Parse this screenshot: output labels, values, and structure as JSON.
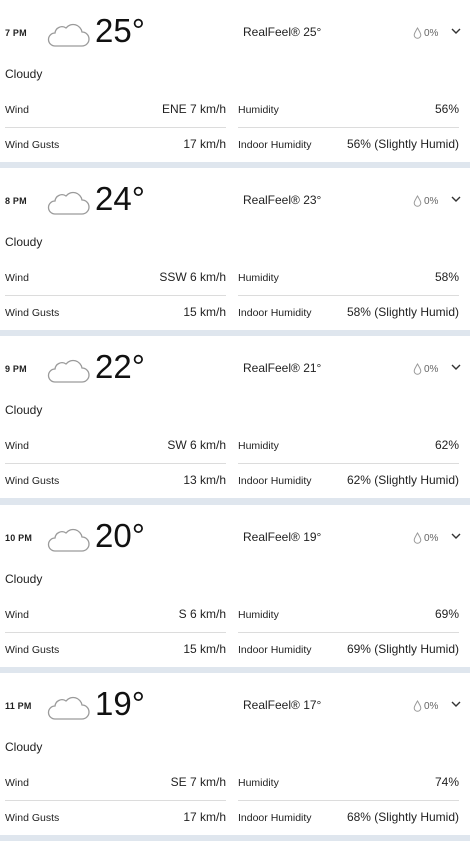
{
  "labels": {
    "wind": "Wind",
    "humidity": "Humidity",
    "wind_gusts": "Wind Gusts",
    "indoor_humidity": "Indoor Humidity"
  },
  "icons": {
    "weather": "cloud-icon",
    "precip": "raindrop-icon",
    "expand": "chevron-down-icon"
  },
  "hours": [
    {
      "time": "7 PM",
      "temp": "25°",
      "realfeel": "RealFeel® 25°",
      "precip": "0%",
      "condition": "Cloudy",
      "wind": "ENE 7 km/h",
      "humidity": "56%",
      "wind_gusts": "17 km/h",
      "indoor_humidity": "56% (Slightly Humid)"
    },
    {
      "time": "8 PM",
      "temp": "24°",
      "realfeel": "RealFeel® 23°",
      "precip": "0%",
      "condition": "Cloudy",
      "wind": "SSW 6 km/h",
      "humidity": "58%",
      "wind_gusts": "15 km/h",
      "indoor_humidity": "58% (Slightly Humid)"
    },
    {
      "time": "9 PM",
      "temp": "22°",
      "realfeel": "RealFeel® 21°",
      "precip": "0%",
      "condition": "Cloudy",
      "wind": "SW 6 km/h",
      "humidity": "62%",
      "wind_gusts": "13 km/h",
      "indoor_humidity": "62% (Slightly Humid)"
    },
    {
      "time": "10 PM",
      "temp": "20°",
      "realfeel": "RealFeel® 19°",
      "precip": "0%",
      "condition": "Cloudy",
      "wind": "S 6 km/h",
      "humidity": "69%",
      "wind_gusts": "15 km/h",
      "indoor_humidity": "69% (Slightly Humid)"
    },
    {
      "time": "11 PM",
      "temp": "19°",
      "realfeel": "RealFeel® 17°",
      "precip": "0%",
      "condition": "Cloudy",
      "wind": "SE 7 km/h",
      "humidity": "74%",
      "wind_gusts": "17 km/h",
      "indoor_humidity": "68% (Slightly Humid)"
    }
  ]
}
